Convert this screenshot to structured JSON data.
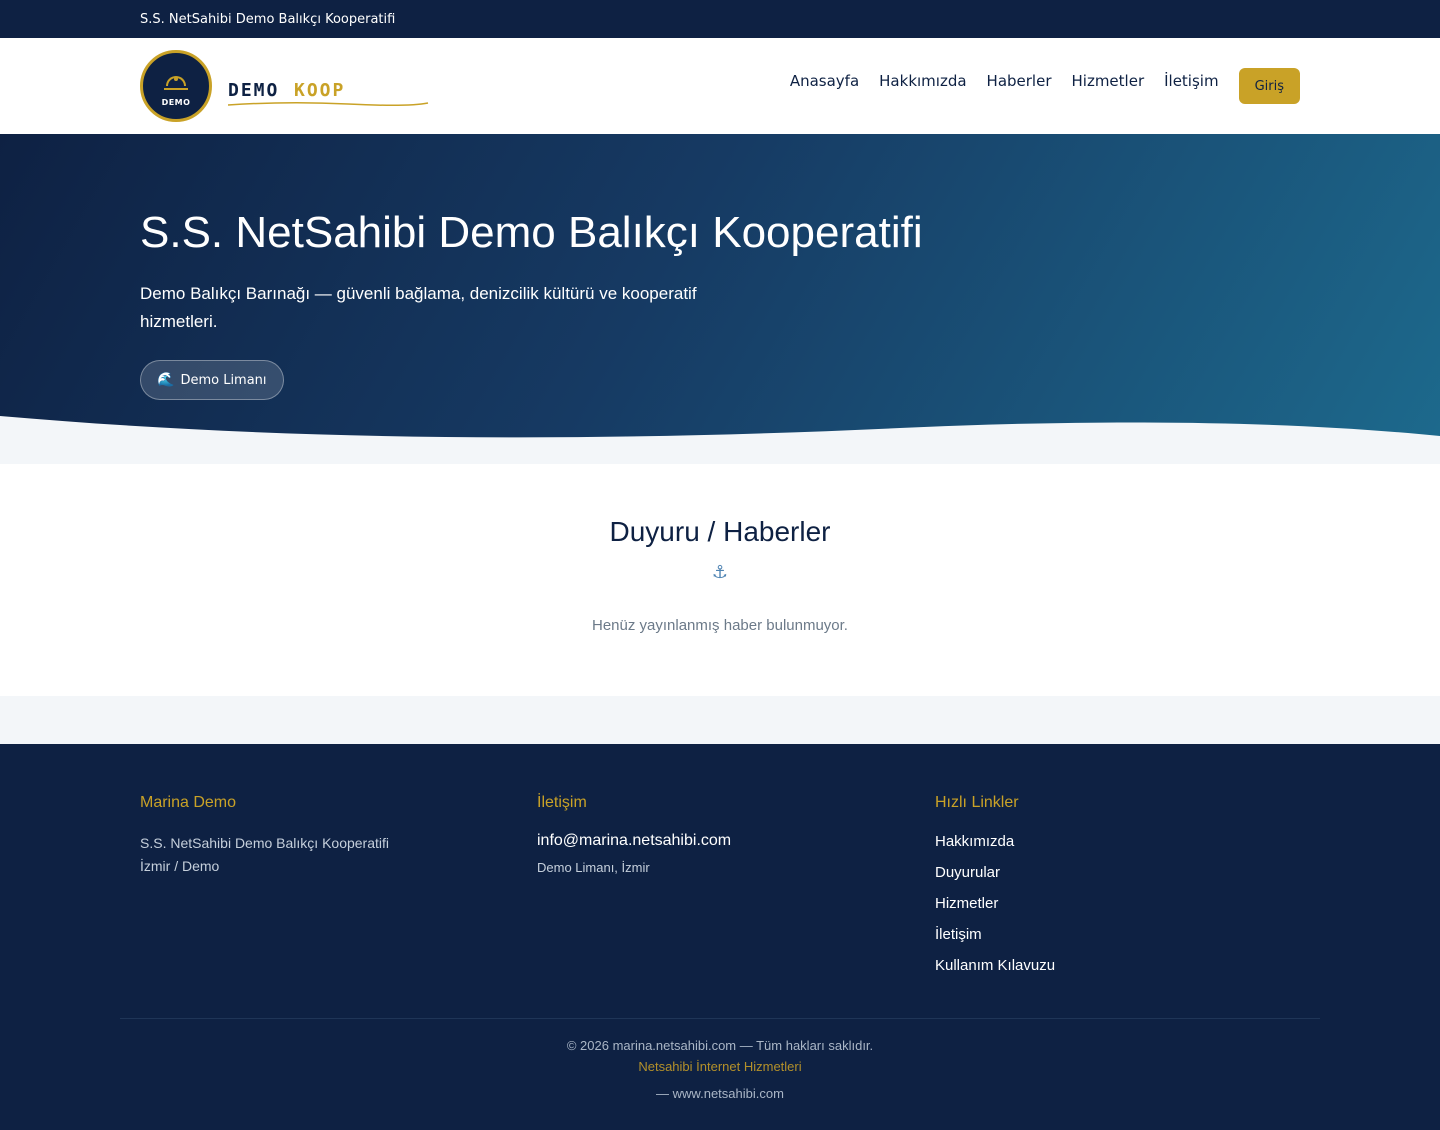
{
  "topbar": {
    "text": "S.S. NetSahibi Demo Balıkçı Kooperatifi"
  },
  "logo": {
    "badge_text": "DEMO",
    "word1": "DEMO",
    "word2": "KOOP"
  },
  "nav": {
    "items": [
      "Anasayfa",
      "Hakkımızda",
      "Haberler",
      "Hizmetler",
      "İletişim"
    ],
    "login": "Giriş"
  },
  "hero": {
    "title": "S.S. NetSahibi Demo Balıkçı Kooperatifi",
    "subtitle": "Demo Balıkçı Barınağı — güvenli bağlama, denizcilik kültürü ve kooperatif hizmetleri.",
    "pill_label": "Demo Limanı",
    "pill_icon": "🌊"
  },
  "news": {
    "title": "Duyuru / Haberler",
    "icon": "⚓",
    "empty": "Henüz yayınlanmış haber bulunmuyor."
  },
  "footer": {
    "col1": {
      "title": "Marina Demo",
      "line1": "S.S. NetSahibi Demo Balıkçı Kooperatifi",
      "line2": "İzmir / Demo"
    },
    "col2": {
      "title": "İletişim",
      "email": "info@marina.netsahibi.com",
      "address": "Demo Limanı, İzmir"
    },
    "col3": {
      "title": "Hızlı Linkler",
      "links": [
        "Hakkımızda",
        "Duyurular",
        "Hizmetler",
        "İletişim",
        "Kullanım Kılavuzu"
      ]
    },
    "copyright": "© 2026 marina.netsahibi.com — Tüm hakları saklıdır.",
    "company": "Netsahibi İnternet Hizmetleri",
    "site": "— www.netsahibi.com"
  },
  "colors": {
    "navy": "#0e2143",
    "gold": "#c9a227",
    "teal": "#1d6a8d"
  }
}
